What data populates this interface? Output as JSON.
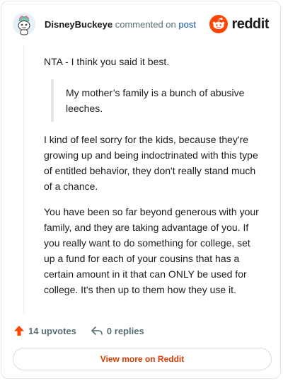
{
  "header": {
    "username": "DisneyBuckeye",
    "action": "commented on",
    "post_link": "post",
    "brand": "reddit"
  },
  "comment": {
    "intro": "NTA - I think you said it best.",
    "quote": "My mother’s family is a bunch of abusive leeches.",
    "paragraphs": [
      "I kind of feel sorry for the kids, because they're growing up and being indoctrinated with this type of entitled behavior, they don't really stand much of a chance.",
      "You have been so far beyond generous with your family, and they are taking advantage of you. If you really want to do something for college, set up a fund for each of your cousins that has a certain amount in it that can ONLY be used for college. It's then up to them how they use it."
    ]
  },
  "actions": {
    "upvotes": "14 upvotes",
    "replies": "0 replies"
  },
  "footer": {
    "view_more": "View more on Reddit"
  },
  "colors": {
    "brand_orange": "#ff4500",
    "link_blue": "#0a4fa3",
    "view_more_text": "#d93a00"
  },
  "icons": {
    "upvote": "upvote-arrow-icon",
    "reply": "reply-arrow-icon",
    "logo": "reddit-snoo-icon"
  }
}
